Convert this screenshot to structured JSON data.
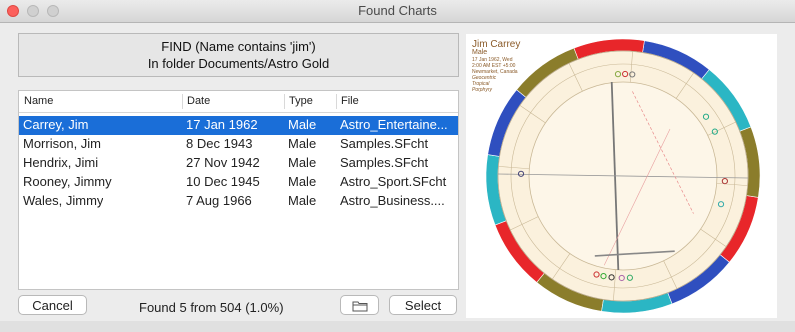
{
  "window": {
    "title": "Found Charts"
  },
  "find": {
    "line1": "FIND (Name contains 'jim')",
    "line2": "In folder Documents/Astro Gold"
  },
  "table": {
    "columns": [
      "Name",
      "Date",
      "Type",
      "File"
    ],
    "rows": [
      {
        "name": "Carrey, Jim",
        "date": "17 Jan 1962",
        "type": "Male",
        "file": "Astro_Entertaine..."
      },
      {
        "name": "Morrison, Jim",
        "date": "8 Dec 1943",
        "type": "Male",
        "file": "Samples.SFcht"
      },
      {
        "name": "Hendrix, Jimi",
        "date": "27 Nov 1942",
        "type": "Male",
        "file": "Samples.SFcht"
      },
      {
        "name": "Rooney, Jimmy",
        "date": "10 Dec 1945",
        "type": "Male",
        "file": "Astro_Sport.SFcht"
      },
      {
        "name": "Wales, Jimmy",
        "date": "7 Aug 1966",
        "type": "Male",
        "file": "Astro_Business...."
      }
    ]
  },
  "buttons": {
    "cancel": "Cancel",
    "select": "Select"
  },
  "status": "Found 5 from 504 (1.0%)",
  "chart_preview": {
    "name": "Jim Carrey",
    "gender": "Male",
    "line1": "17 Jan 1962, Wed",
    "line2": "2:00 AM EST +5:00",
    "line3": "Newmarket, Canada",
    "line4": "Geocentric",
    "line5": "Tropical",
    "line6": "Porphyry"
  },
  "colors": {
    "selection": "#1a6ed8",
    "fire": "#e8262a",
    "earth": "#8b7d2b",
    "air": "#2bb6c4",
    "water": "#2f4fbf",
    "wheel_bg": "#fbf1dd"
  }
}
